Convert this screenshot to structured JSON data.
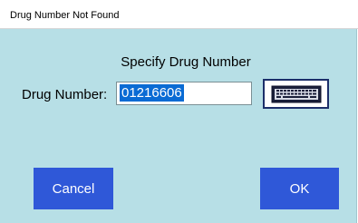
{
  "window": {
    "title": "Drug Number Not Found"
  },
  "dialog": {
    "heading": "Specify Drug Number",
    "field_label": "Drug Number:",
    "field_value": "01216606",
    "keyboard_icon": "keyboard-icon",
    "cancel_label": "Cancel",
    "ok_label": "OK"
  },
  "colors": {
    "dialog_background": "#b7dfe6",
    "button_blue": "#2f58d8",
    "selection_blue": "#0a6bd4",
    "keyboard_border": "#1c2f6a"
  }
}
